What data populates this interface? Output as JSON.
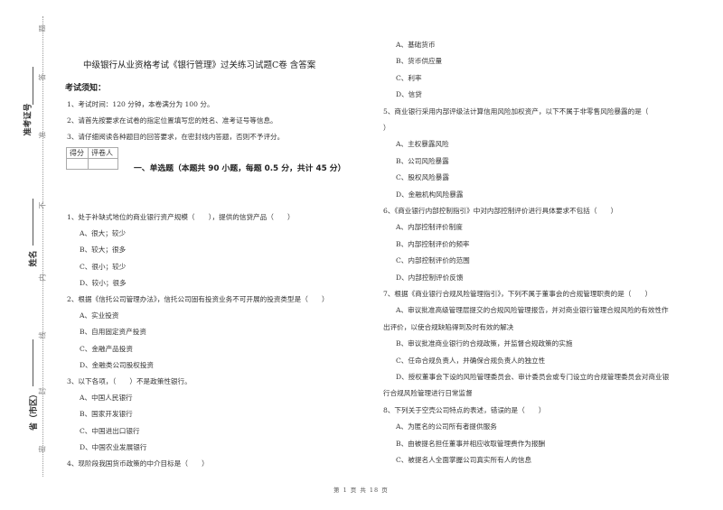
{
  "document": {
    "title": "中级银行从业资格考试《银行管理》过关练习试题C卷 含答案",
    "notice_heading": "考试须知：",
    "notices": [
      "1、考试时间：120 分钟，本卷满分为 100 分。",
      "2、请首先按要求在试卷的指定位置填写您的姓名、准考证号等信息。",
      "3、请仔细阅读各种题目的回答要求，在密封线内答题，否则不予评分。"
    ],
    "score_table": {
      "col1": "得分",
      "col2": "评卷人"
    },
    "section_title": "一、单选题（本题共 90 小题，每题 0.5 分，共计 45 分）",
    "footer": "第 1 页 共 18 页"
  },
  "binding": {
    "seal_chars": [
      "题",
      "答",
      "准",
      "不",
      "内",
      "线",
      "封",
      "密"
    ],
    "fields": [
      "准考证号",
      "姓名",
      "省（市区）"
    ]
  },
  "left_column": [
    {
      "text": "1、处于补缺式地位的商业银行资产规模（　　），提供的信贷产品（　　）",
      "type": "q"
    },
    {
      "text": "A、很大；较少",
      "type": "o"
    },
    {
      "text": "B、较大；很多",
      "type": "o"
    },
    {
      "text": "C、很小；较少",
      "type": "o"
    },
    {
      "text": "D、较小；很多",
      "type": "o"
    },
    {
      "text": "2、根据《信托公司管理办法》，信托公司固有投资业务不可开展的投资类型是（　　）",
      "type": "q"
    },
    {
      "text": "A、实业投资",
      "type": "o"
    },
    {
      "text": "B、自用固定资产投资",
      "type": "o"
    },
    {
      "text": "C、金融产品投资",
      "type": "o"
    },
    {
      "text": "D、金融类公司股权投资",
      "type": "o"
    },
    {
      "text": "3、以下各项，（　　）不是政策性银行。",
      "type": "q"
    },
    {
      "text": "A、中国人民银行",
      "type": "o"
    },
    {
      "text": "B、国家开发银行",
      "type": "o"
    },
    {
      "text": "C、中国进出口银行",
      "type": "o"
    },
    {
      "text": "D、中国农业发展银行",
      "type": "o"
    },
    {
      "text": "4、现阶段我国货币政策的中介目标是（　　）",
      "type": "q"
    }
  ],
  "right_column": [
    {
      "text": "A、基础货币",
      "type": "o"
    },
    {
      "text": "B、货币供应量",
      "type": "o"
    },
    {
      "text": "C、利率",
      "type": "o"
    },
    {
      "text": "D、信贷",
      "type": "o"
    },
    {
      "text": "5、商业银行采用内部评级法计算信用风险加权资产，以下不属于非零售风险暴露的是（",
      "type": "q"
    },
    {
      "text": "）",
      "type": "q"
    },
    {
      "text": "A、主权暴露风险",
      "type": "o"
    },
    {
      "text": "B、公司风险暴露",
      "type": "o"
    },
    {
      "text": "C、股权风险暴露",
      "type": "o"
    },
    {
      "text": "D、金融机构风险暴露",
      "type": "o"
    },
    {
      "text": "6、《商业银行内部控制指引》中对内部控制评价进行具体要求不包括（　　）",
      "type": "q"
    },
    {
      "text": "A、内部控制评价制度",
      "type": "o"
    },
    {
      "text": "B、内部控制评价的频率",
      "type": "o"
    },
    {
      "text": "C、内部控制评价的范围",
      "type": "o"
    },
    {
      "text": "D、内部控制评价反馈",
      "type": "o"
    },
    {
      "text": "7、根据《商业银行合规风险管理指引》，下列不属于董事会的合规管理职责的是（　　）",
      "type": "q"
    },
    {
      "text": "A、审议批准高级管理层提交的合规风险管理报告，并对商业银行管理合规风险的有效性作",
      "type": "o"
    },
    {
      "text": "出评价，以使合规缺陷得到及时有效的解决",
      "type": "c"
    },
    {
      "text": "B、审议批准商业银行的合规政策，并监督合规政策的实施",
      "type": "o"
    },
    {
      "text": "C、任命合规负责人，并确保合规负责人的独立性",
      "type": "o"
    },
    {
      "text": "D、授权董事会下设的风险管理委员会、审计委员会或专门设立的合规管理委员会对商业银",
      "type": "o"
    },
    {
      "text": "行合规风险管理进行日常监督",
      "type": "c"
    },
    {
      "text": "8、下列关于空壳公司特点的表述，错误的是（　　）",
      "type": "q"
    },
    {
      "text": "A、为匿名的公司所有者提供服务",
      "type": "o"
    },
    {
      "text": "B、由被提名担任董事并相应收取管理费作为报酬",
      "type": "o"
    },
    {
      "text": "C、被提名人全面掌握公司真实所有人的信息",
      "type": "o"
    }
  ]
}
